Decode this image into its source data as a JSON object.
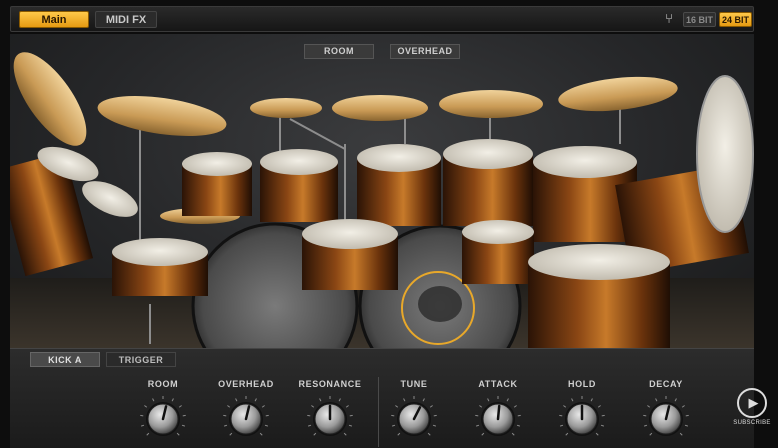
{
  "header": {
    "tabs": [
      {
        "label": "Main",
        "active": true
      },
      {
        "label": "MIDI FX",
        "active": false
      }
    ],
    "bit_options": [
      {
        "label": "16 BIT",
        "active": false
      },
      {
        "label": "24 BIT",
        "active": true
      }
    ],
    "tuner_icon": "tuning-fork-icon"
  },
  "views": {
    "room_label": "ROOM",
    "overhead_label": "OVERHEAD"
  },
  "panel": {
    "tabs": [
      {
        "label": "KICK A",
        "active": true
      },
      {
        "label": "TRIGGER",
        "active": false
      }
    ],
    "knobs": [
      {
        "label": "ROOM",
        "value": 0.55
      },
      {
        "label": "OVERHEAD",
        "value": 0.55
      },
      {
        "label": "RESONANCE",
        "value": 0.5
      },
      {
        "label": "TUNE",
        "value": 0.6
      },
      {
        "label": "ATTACK",
        "value": 0.52
      },
      {
        "label": "HOLD",
        "value": 0.5
      },
      {
        "label": "DECAY",
        "value": 0.55
      }
    ]
  },
  "overlay": {
    "subscribe_label": "SUBSCRIBE"
  },
  "colors": {
    "accent": "#f0aa22",
    "drum_shell": "#7a3d10",
    "cymbal": "#d8b070"
  }
}
